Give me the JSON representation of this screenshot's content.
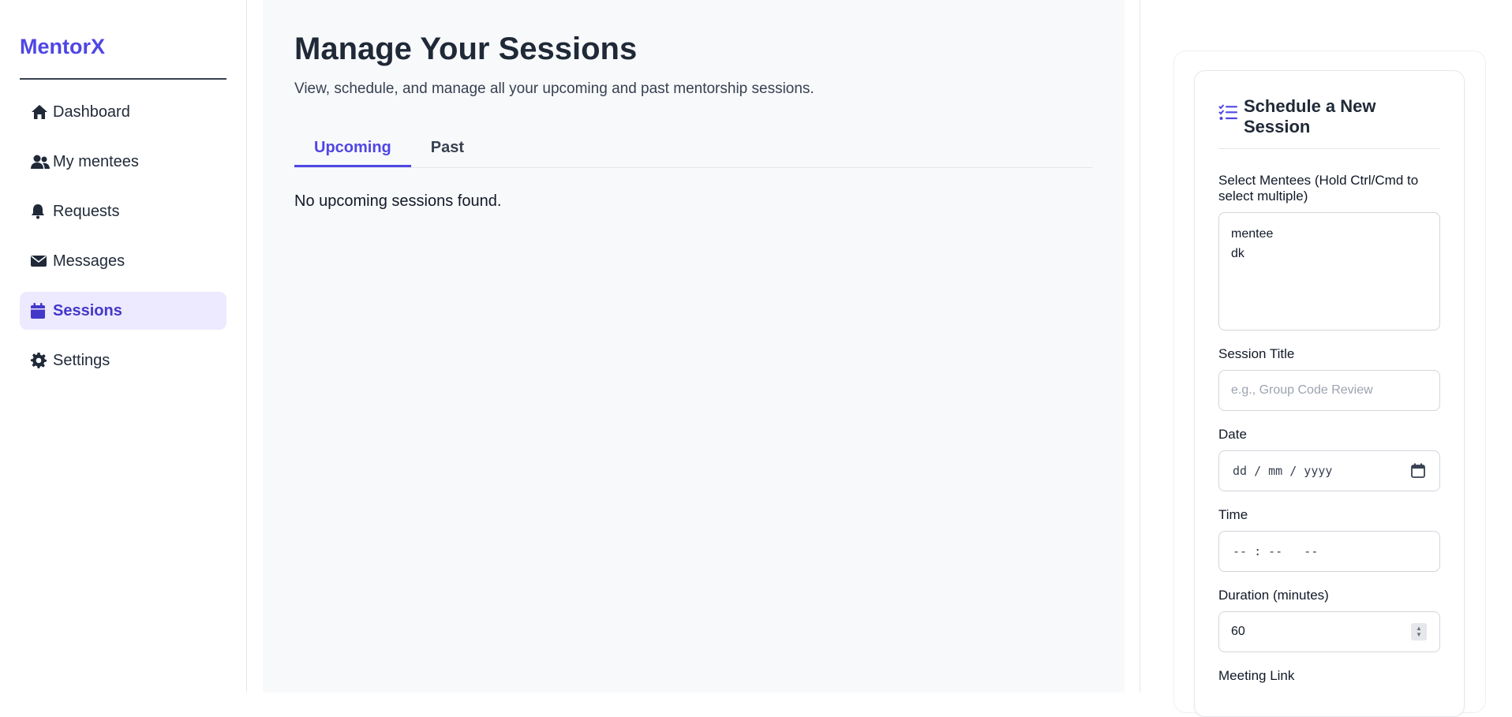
{
  "sidebar": {
    "brand": "MentorX",
    "items": [
      {
        "label": "Dashboard",
        "icon": "home-icon"
      },
      {
        "label": "My mentees",
        "icon": "users-icon"
      },
      {
        "label": "Requests",
        "icon": "bell-icon"
      },
      {
        "label": "Messages",
        "icon": "envelope-icon"
      },
      {
        "label": "Sessions",
        "icon": "calendar-icon",
        "active": true
      },
      {
        "label": "Settings",
        "icon": "gear-icon"
      }
    ]
  },
  "main": {
    "title": "Manage Your Sessions",
    "subtitle": "View, schedule, and manage all your upcoming and past mentorship sessions.",
    "tabs": [
      {
        "label": "Upcoming",
        "active": true
      },
      {
        "label": "Past",
        "active": false
      }
    ],
    "empty_message": "No upcoming sessions found."
  },
  "form": {
    "title": "Schedule a New Session",
    "icon": "tasks-icon",
    "mentees_label": "Select Mentees (Hold Ctrl/Cmd to select multiple)",
    "mentees_options": [
      "mentee",
      "dk"
    ],
    "title_label": "Session Title",
    "title_placeholder": "e.g., Group Code Review",
    "date_label": "Date",
    "date_placeholder": "dd / mm / yyyy",
    "time_label": "Time",
    "time_placeholder": "-- : --   --",
    "duration_label": "Duration (minutes)",
    "duration_value": "60",
    "link_label": "Meeting Link"
  },
  "colors": {
    "accent": "#4f46e5",
    "active_bg": "#ede9fe",
    "main_bg": "#f8f9fb"
  }
}
